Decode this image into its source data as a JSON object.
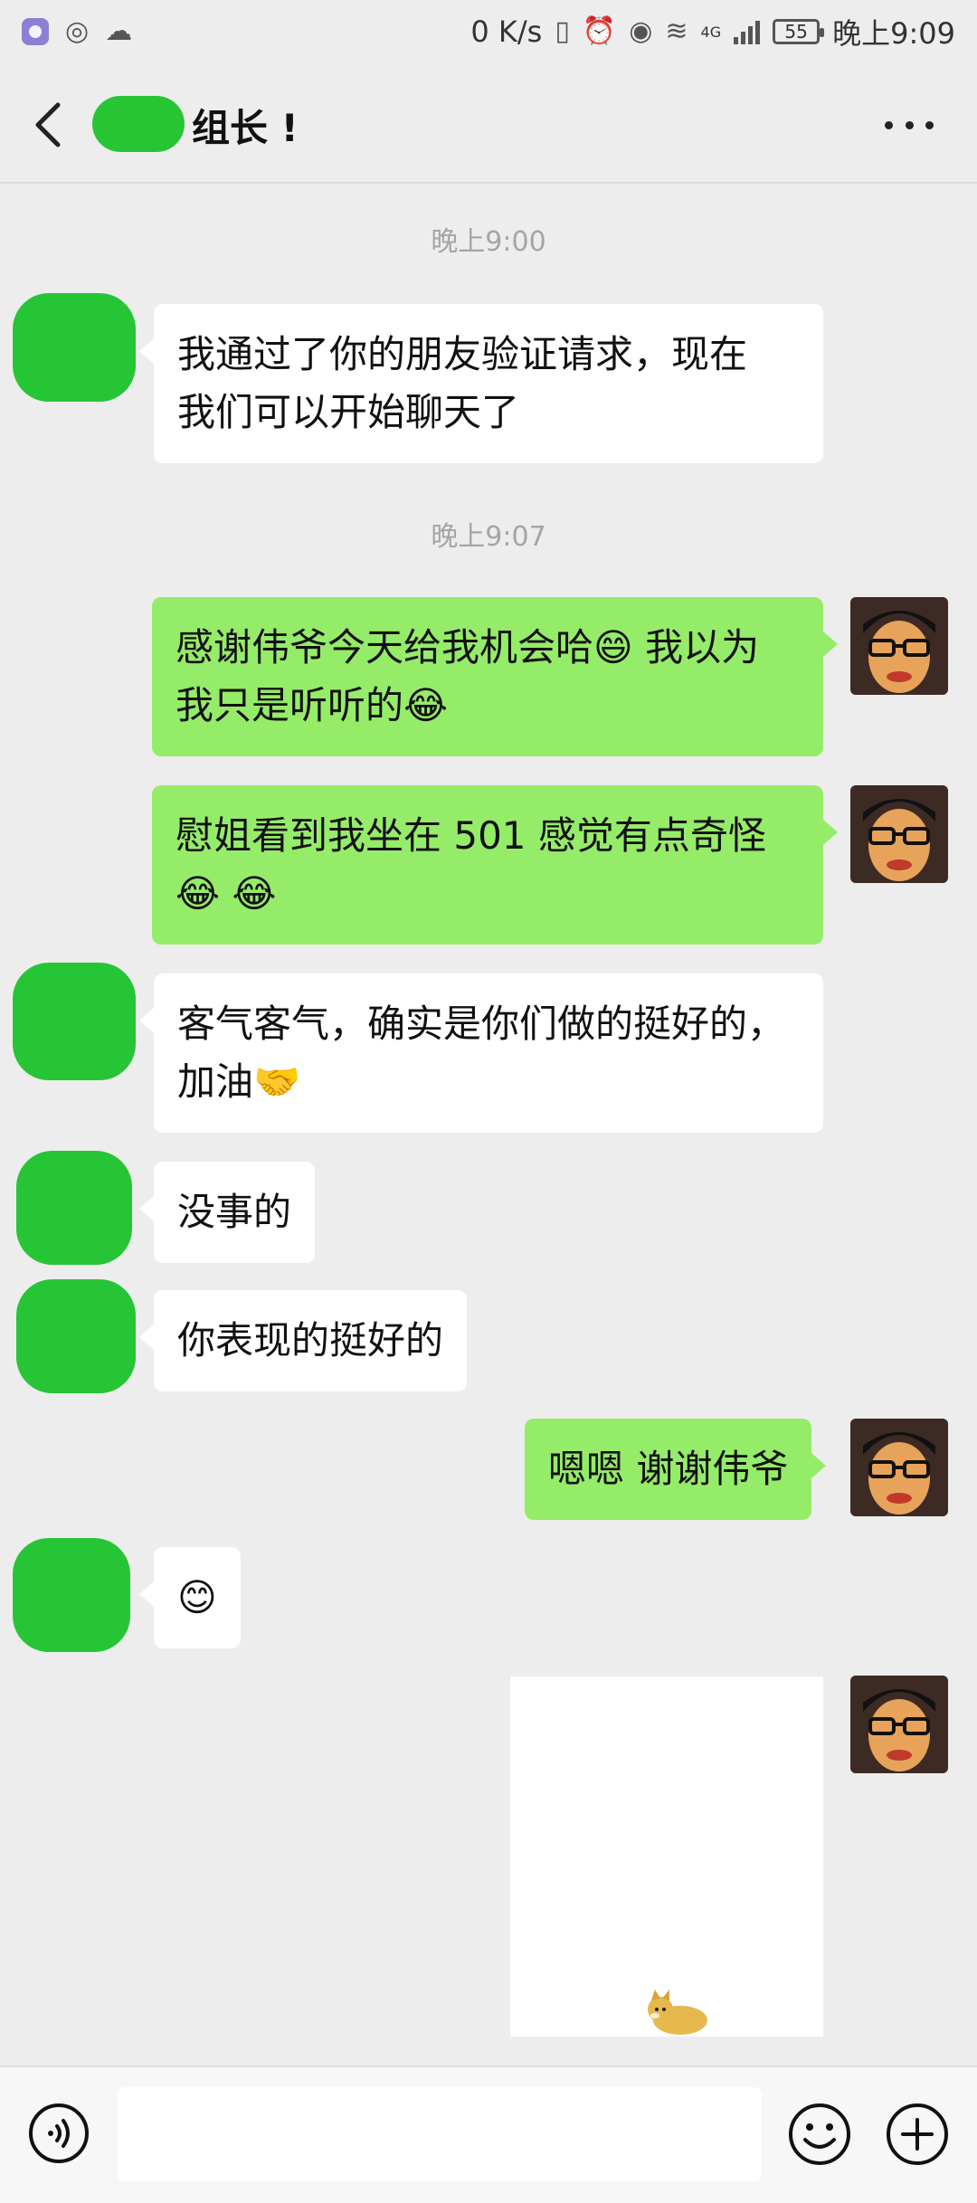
{
  "status_bar": {
    "net_speed": "0 K/s",
    "network_type": "4G",
    "battery": "55",
    "time": "晚上9:09"
  },
  "header": {
    "title": "组长 !"
  },
  "messages": [
    {
      "type": "timestamp",
      "text": "晚上9:00"
    },
    {
      "type": "in",
      "lines": [
        "我通过了你的朋友验证请求，现在",
        "我们可以开始聊天了"
      ]
    },
    {
      "type": "timestamp",
      "text": "晚上9:07"
    },
    {
      "type": "out",
      "lines": [
        "感谢伟爷今天给我机会哈😄 我以为",
        "我只是听听的😂"
      ]
    },
    {
      "type": "out",
      "lines": [
        "慰姐看到我坐在 501 感觉有点奇怪",
        "😂 😂"
      ]
    },
    {
      "type": "in",
      "lines": [
        "客气客气，确实是你们做的挺好的，",
        "加油🤝"
      ]
    },
    {
      "type": "in",
      "lines": [
        "没事的"
      ]
    },
    {
      "type": "in",
      "lines": [
        "你表现的挺好的"
      ]
    },
    {
      "type": "out",
      "lines": [
        "嗯嗯 谢谢伟爷"
      ]
    },
    {
      "type": "in",
      "lines": [
        "😊"
      ]
    }
  ],
  "icons": {
    "back": "chevron-left-icon",
    "more": "more-dots-icon",
    "voice": "voice-icon",
    "emoji": "smile-icon",
    "plus": "plus-icon"
  },
  "colors": {
    "incoming_bubble": "#ffffff",
    "outgoing_bubble": "#95ec69",
    "redaction_green": "#26c535",
    "background": "#ededed"
  }
}
